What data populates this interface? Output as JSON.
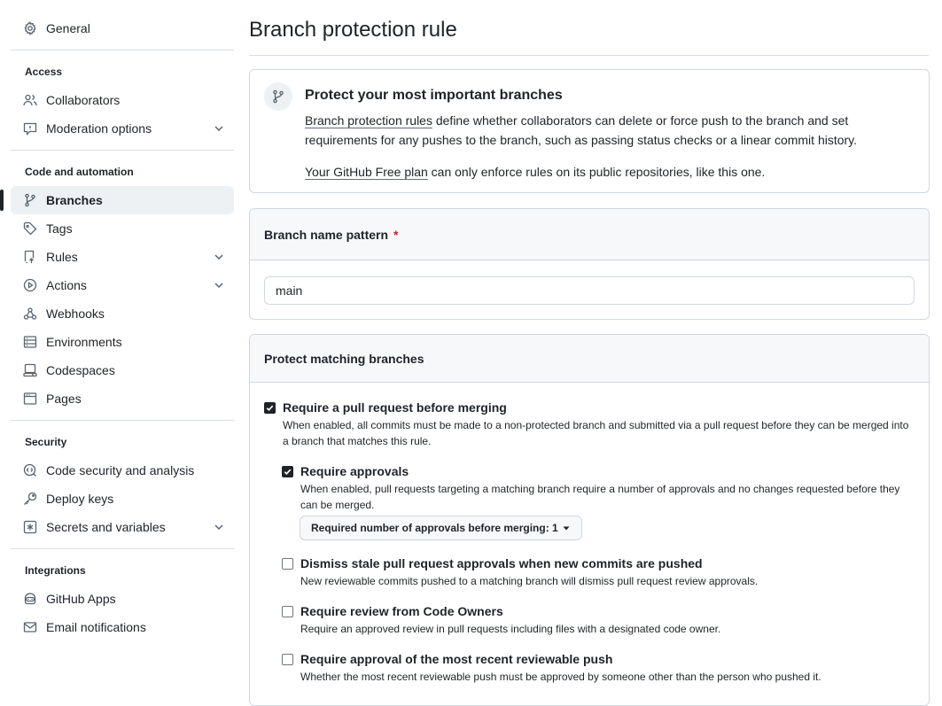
{
  "sidebar": {
    "general": "General",
    "access_heading": "Access",
    "collaborators": "Collaborators",
    "moderation": "Moderation options",
    "code_heading": "Code and automation",
    "branches": "Branches",
    "tags": "Tags",
    "rules": "Rules",
    "actions": "Actions",
    "webhooks": "Webhooks",
    "environments": "Environments",
    "codespaces": "Codespaces",
    "pages": "Pages",
    "security_heading": "Security",
    "code_security": "Code security and analysis",
    "deploy_keys": "Deploy keys",
    "secrets": "Secrets and variables",
    "integrations_heading": "Integrations",
    "github_apps": "GitHub Apps",
    "email_notifications": "Email notifications"
  },
  "main": {
    "title": "Branch protection rule",
    "info": {
      "title": "Protect your most important branches",
      "link1": "Branch protection rules",
      "desc_rest": " define whether collaborators can delete or force push to the branch and set requirements for any pushes to the branch, such as passing status checks or a linear commit history.",
      "link2": "Your GitHub Free plan",
      "plan_rest": " can only enforce rules on its public repositories, like this one."
    },
    "pattern": {
      "header": "Branch name pattern",
      "required_mark": "*",
      "value": "main"
    },
    "protect": {
      "header": "Protect matching branches",
      "options": [
        {
          "label": "Require a pull request before merging",
          "desc": "When enabled, all commits must be made to a non-protected branch and submitted via a pull request before they can be merged into a branch that matches this rule.",
          "checked": true
        },
        {
          "label": "Require approvals",
          "desc": "When enabled, pull requests targeting a matching branch require a number of approvals and no changes requested before they can be merged.",
          "checked": true
        },
        {
          "label": "Dismiss stale pull request approvals when new commits are pushed",
          "desc": "New reviewable commits pushed to a matching branch will dismiss pull request review approvals.",
          "checked": false
        },
        {
          "label": "Require review from Code Owners",
          "desc": "Require an approved review in pull requests including files with a designated code owner.",
          "checked": false
        },
        {
          "label": "Require approval of the most recent reviewable push",
          "desc": "Whether the most recent reviewable push must be approved by someone other than the person who pushed it.",
          "checked": false
        }
      ],
      "approvals_select": "Required number of approvals before merging: 1"
    }
  },
  "colors": {
    "text": "#1f2328",
    "border": "#d0d7de",
    "header_bg": "#f6f8fa",
    "active_bg": "#eef1f4",
    "required": "#cf222e"
  },
  "icons": [
    "gear-icon",
    "people-icon",
    "report-icon",
    "git-branch-icon",
    "tag-icon",
    "repo-push-icon",
    "play-icon",
    "webhook-icon",
    "server-icon",
    "codespaces-icon",
    "browser-icon",
    "codescan-icon",
    "key-icon",
    "asterisk-icon",
    "apps-icon",
    "mail-icon",
    "chevron-down-icon",
    "check-icon",
    "triangle-down-icon"
  ]
}
